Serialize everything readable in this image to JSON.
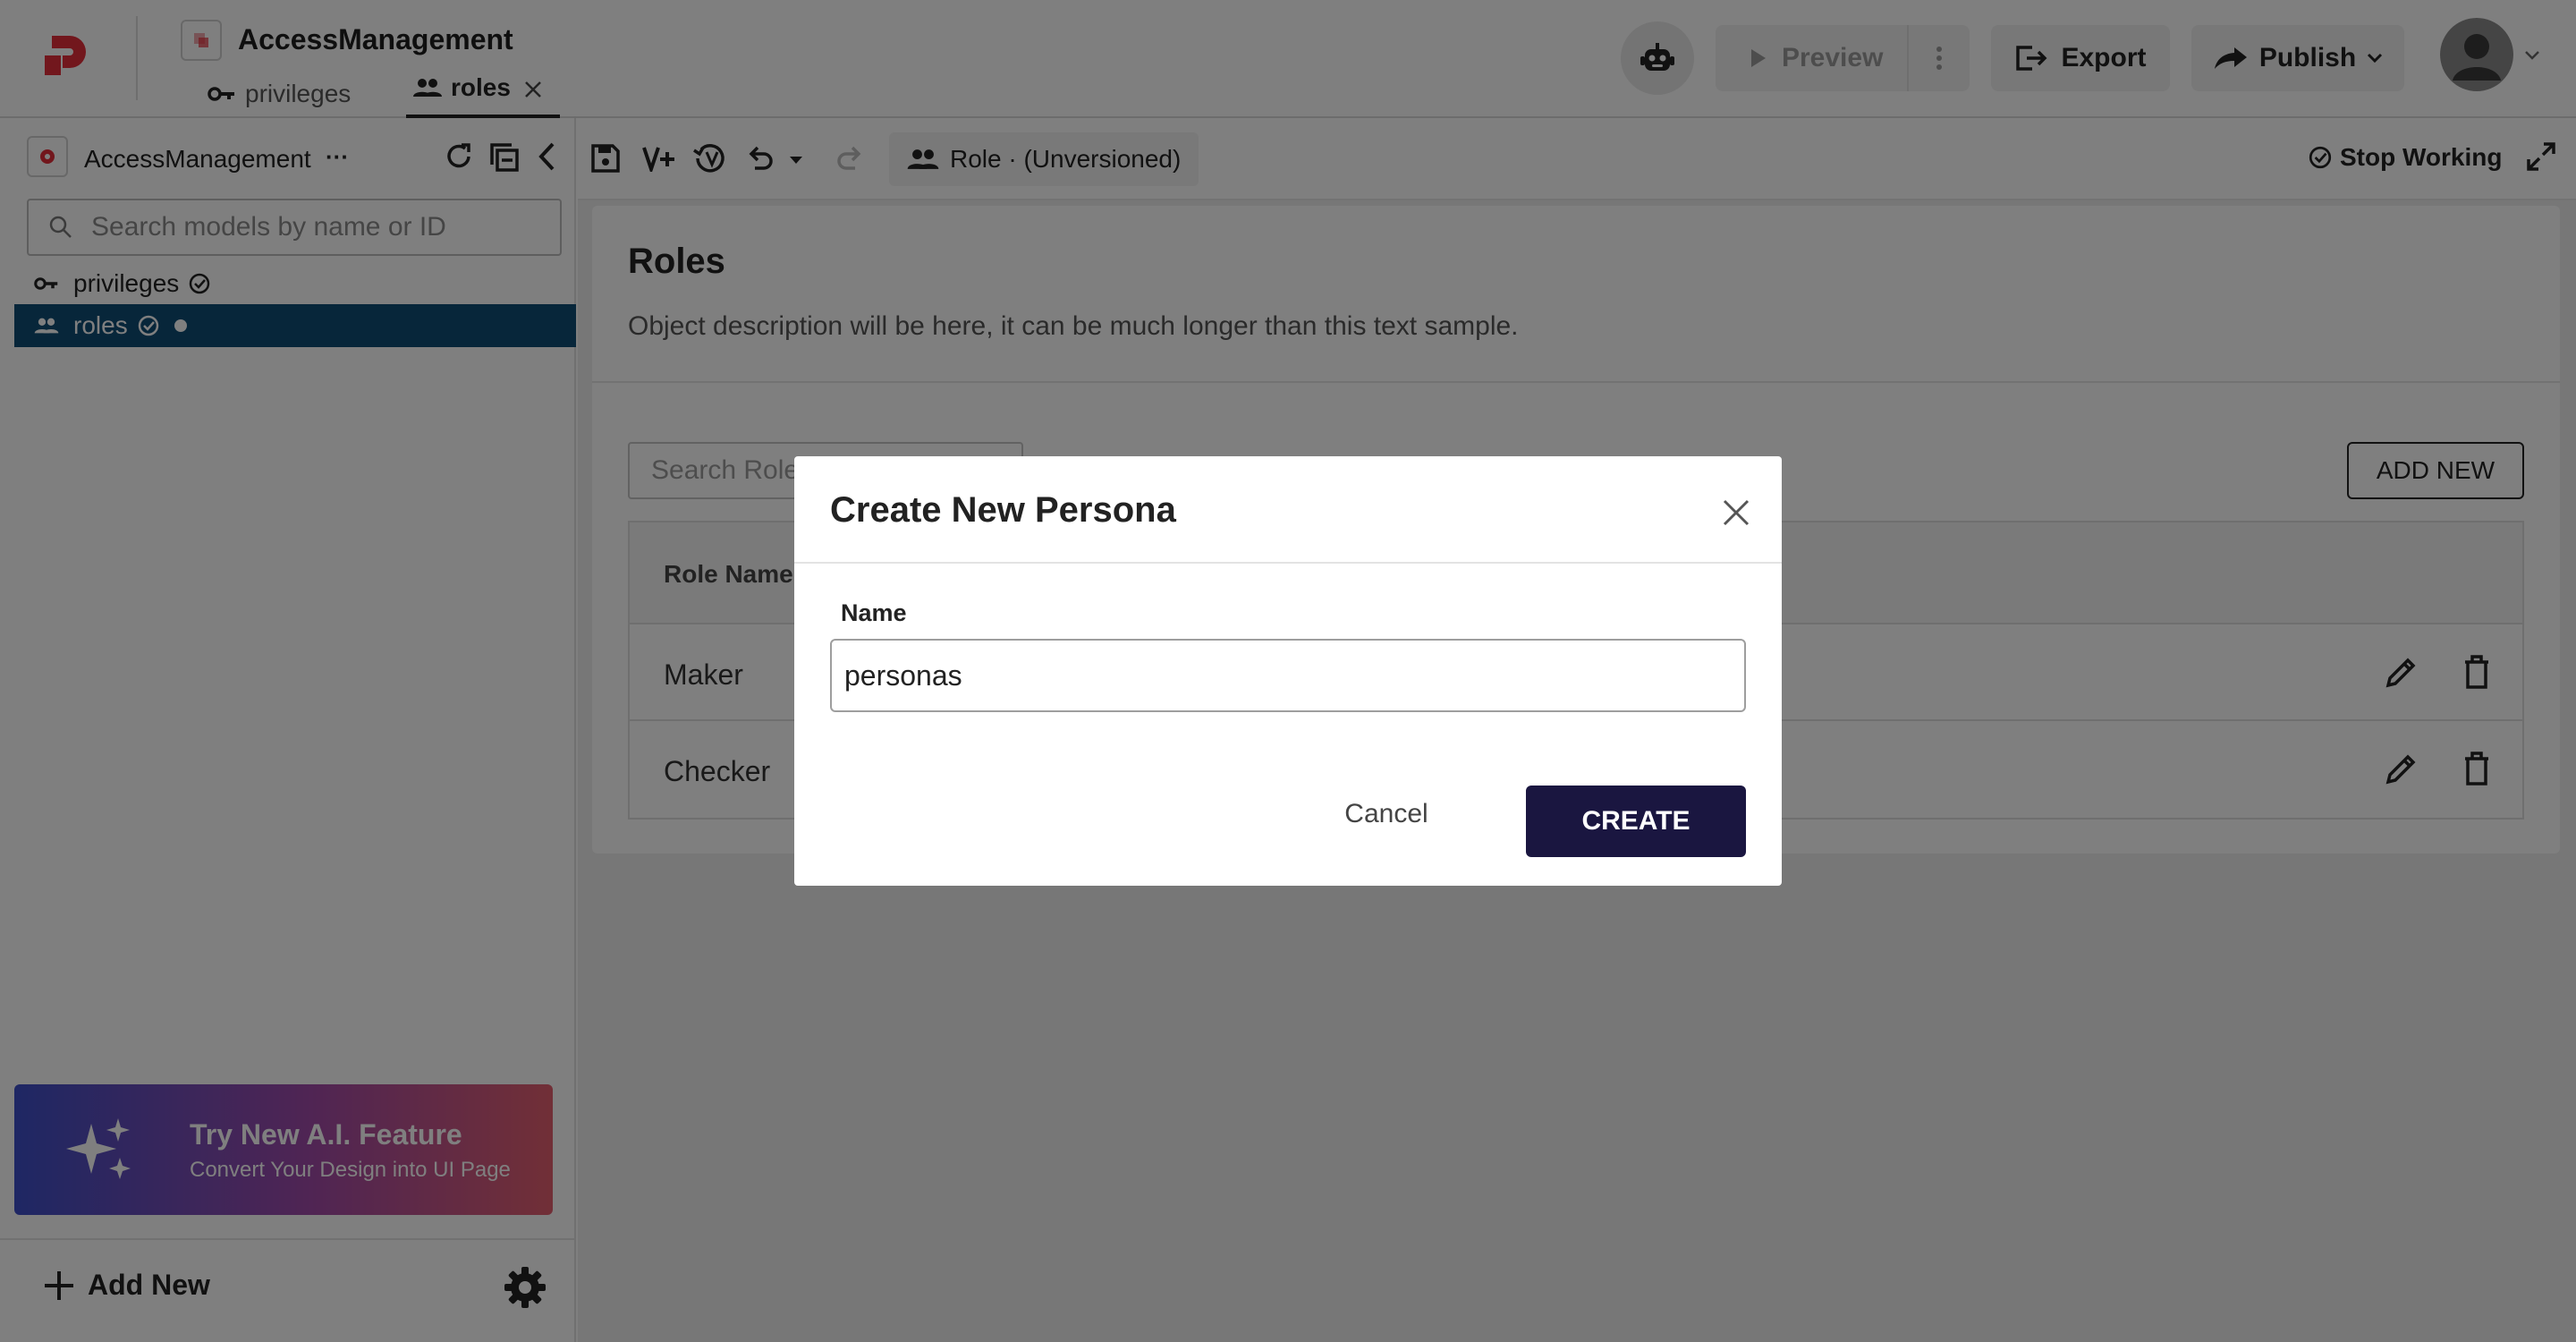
{
  "app": {
    "title": "AccessManagement",
    "tabs": [
      {
        "label": "privileges",
        "icon": "key-icon"
      },
      {
        "label": "roles",
        "icon": "people-icon",
        "active": true
      }
    ]
  },
  "header": {
    "preview_label": "Preview",
    "export_label": "Export",
    "publish_label": "Publish"
  },
  "sidebar": {
    "project_name": "AccessManagement",
    "more": "···",
    "search_placeholder": "Search models by name or ID",
    "items": [
      {
        "label": "privileges",
        "icon": "key-icon"
      },
      {
        "label": "roles",
        "icon": "people-icon",
        "selected": true
      }
    ],
    "promo_title": "Try New A.I. Feature",
    "promo_subtitle": "Convert Your Design into UI Page",
    "add_new_label": "Add New"
  },
  "toolbar": {
    "role_label": "Role · (Unversioned)",
    "stop_working_label": "Stop Working"
  },
  "main": {
    "title": "Roles",
    "description": "Object description will be here, it can be much longer than this text sample.",
    "search_placeholder": "Search Roles",
    "add_new_label": "ADD NEW",
    "table": {
      "columns": [
        "Role Name"
      ],
      "rows": [
        {
          "name": "Maker"
        },
        {
          "name": "Checker"
        }
      ]
    }
  },
  "modal": {
    "title": "Create New Persona",
    "name_label": "Name",
    "name_value": "personas",
    "cancel_label": "Cancel",
    "create_label": "CREATE"
  },
  "colors": {
    "brand": "#e52e3b",
    "selected_bg": "#0f4c75",
    "create_btn": "#1a1640",
    "overlay": "rgba(0,0,0,0.5)"
  }
}
